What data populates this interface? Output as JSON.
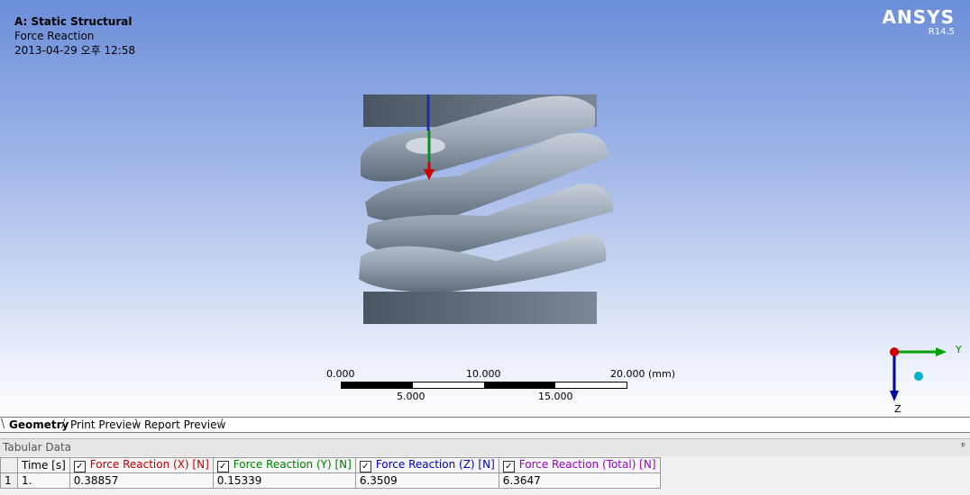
{
  "header": {
    "title": "A: Static Structural",
    "subtitle": "Force Reaction",
    "timestamp": "2013-04-29 오후 12:58"
  },
  "brand": {
    "name": "ANSYS",
    "version": "R14.5"
  },
  "scale": {
    "top_labels": [
      "0.000",
      "10.000",
      "20.000 (mm)"
    ],
    "bottom_labels": [
      "5.000",
      "15.000"
    ]
  },
  "triad": {
    "y_label": "Y",
    "z_label": "Z"
  },
  "tabs": [
    {
      "label": "Geometry"
    },
    {
      "label": "Print Preview"
    },
    {
      "label": "Report Preview"
    }
  ],
  "tabular": {
    "title": "Tabular Data",
    "columns": [
      "Time [s]",
      "Force Reaction (X) [N]",
      "Force Reaction (Y) [N]",
      "Force Reaction (Z) [N]",
      "Force Reaction (Total) [N]"
    ],
    "column_colors": [
      "#000000",
      "#c00000",
      "#008000",
      "#0000c0",
      "#9900cc"
    ],
    "rows": [
      {
        "index": "1",
        "values": [
          "1.",
          "0.38857",
          "0.15339",
          "6.3509",
          "6.3647"
        ]
      }
    ]
  },
  "icons": {
    "pin": "pin-icon",
    "checkbox": "checkbox-checked-icon"
  },
  "colors": {
    "viewport_top": "#6b8ed9",
    "spring": "#a7b2c0",
    "x_axis": "#cc0000",
    "y_axis": "#00a000",
    "z_axis": "#0000aa"
  }
}
